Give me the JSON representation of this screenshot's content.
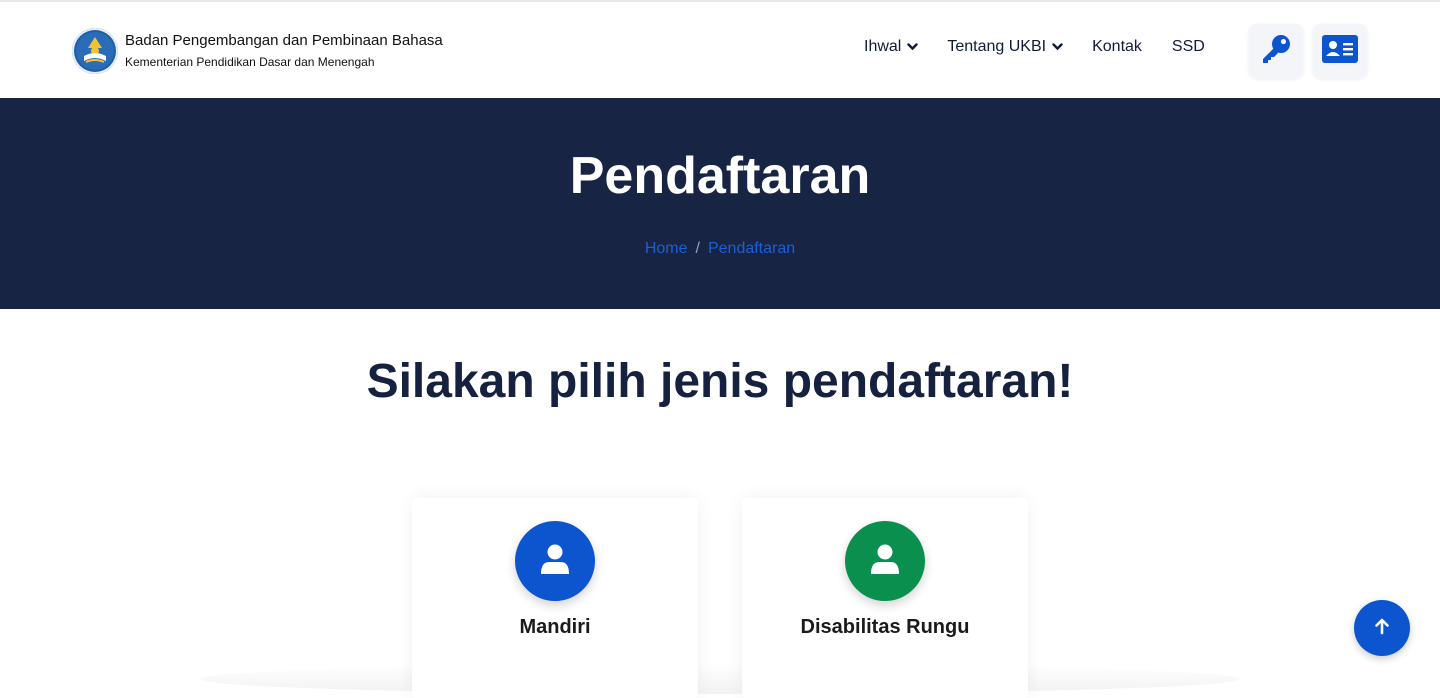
{
  "brand": {
    "title": "Badan Pengembangan dan Pembinaan Bahasa",
    "subtitle": "Kementerian Pendidikan Dasar dan Menengah"
  },
  "nav": {
    "items": [
      {
        "label": "Ihwal",
        "dropdown": true
      },
      {
        "label": "Tentang UKBI",
        "dropdown": true
      },
      {
        "label": "Kontak",
        "dropdown": false
      },
      {
        "label": "SSD",
        "dropdown": false
      }
    ]
  },
  "header_buttons": {
    "login_icon": "key-icon",
    "register_icon": "id-card-icon"
  },
  "hero": {
    "title": "Pendaftaran",
    "breadcrumb": [
      "Home",
      "Pendaftaran"
    ],
    "breadcrumb_separator": "/"
  },
  "main": {
    "heading": "Silakan pilih jenis pendaftaran!",
    "options": [
      {
        "label": "Mandiri",
        "icon": "user-icon",
        "color": "#0d54cf"
      },
      {
        "label": "Disabilitas Rungu",
        "icon": "user-icon",
        "color": "#0a8f4f"
      }
    ]
  },
  "colors": {
    "navy": "#172443",
    "primary_blue": "#0d54cf",
    "green": "#0a8f4f",
    "link_blue": "#1d5fd8"
  }
}
